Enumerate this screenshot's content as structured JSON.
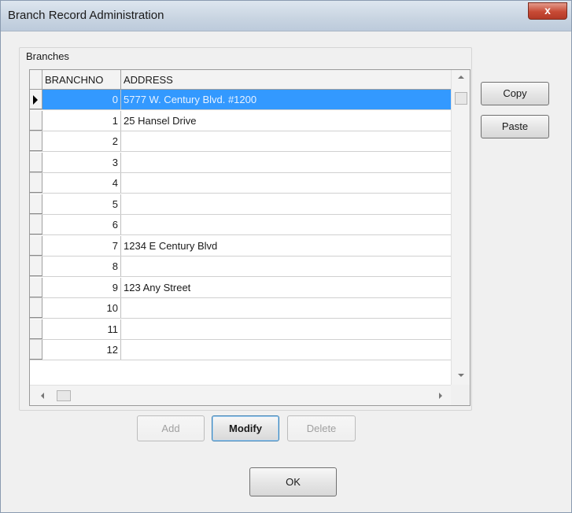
{
  "window": {
    "title": "Branch Record Administration",
    "close_label": "x"
  },
  "group": {
    "label": "Branches"
  },
  "grid": {
    "columns": [
      "BRANCHNO",
      "ADDRESS"
    ],
    "selected_index": 0,
    "rows": [
      {
        "no": "0",
        "address": "5777 W. Century Blvd. #1200"
      },
      {
        "no": "1",
        "address": "25 Hansel Drive"
      },
      {
        "no": "2",
        "address": ""
      },
      {
        "no": "3",
        "address": ""
      },
      {
        "no": "4",
        "address": ""
      },
      {
        "no": "5",
        "address": ""
      },
      {
        "no": "6",
        "address": ""
      },
      {
        "no": "7",
        "address": "1234 E Century Blvd"
      },
      {
        "no": "8",
        "address": ""
      },
      {
        "no": "9",
        "address": "123 Any Street"
      },
      {
        "no": "10",
        "address": ""
      },
      {
        "no": "11",
        "address": ""
      },
      {
        "no": "12",
        "address": ""
      }
    ]
  },
  "buttons": {
    "copy": "Copy",
    "paste": "Paste",
    "add": "Add",
    "modify": "Modify",
    "delete": "Delete",
    "ok": "OK"
  },
  "colors": {
    "selection": "#3399ff",
    "close_button": "#c74a35"
  },
  "icons": {
    "row_indicator": "triangle-right-icon",
    "scroll_up": "arrow-up-icon",
    "scroll_down": "arrow-down-icon",
    "scroll_left": "arrow-left-icon",
    "scroll_right": "arrow-right-icon"
  }
}
